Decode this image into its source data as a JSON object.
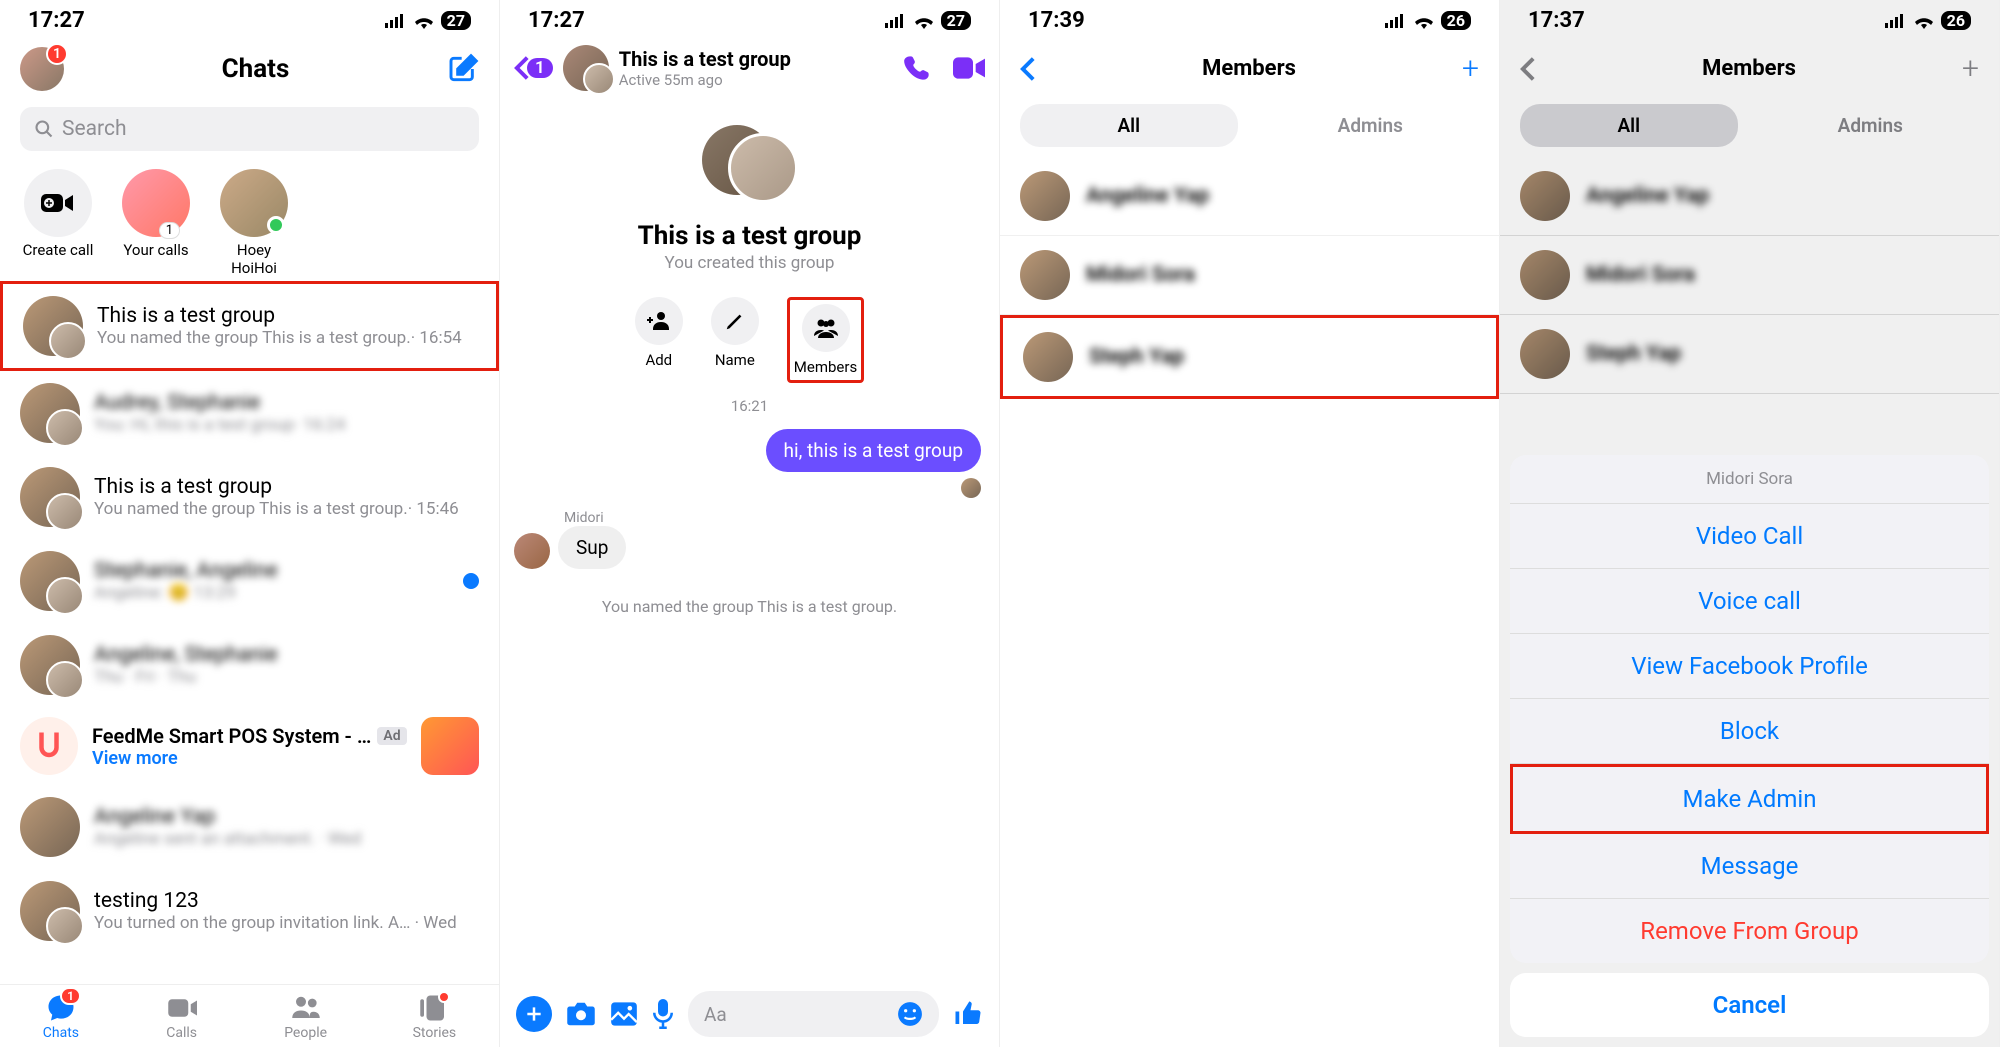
{
  "status": {
    "signal_icon": "signal",
    "wifi_icon": "wifi"
  },
  "p1": {
    "time": "17:27",
    "battery": "27",
    "avatar_badge": "1",
    "title": "Chats",
    "search_placeholder": "Search",
    "horiz": {
      "create_call": "Create call",
      "your_calls": "Your calls",
      "your_calls_badge": "1",
      "person": "Hoey HoiHoi"
    },
    "chats": [
      {
        "title": "This is a test group",
        "sub": "You named the group This is a test group.· 16:54",
        "highlight": true,
        "double": true
      },
      {
        "title": "Audrey, Stephanie",
        "sub": "You: Hi, this is a test group· 16:24",
        "blur": true,
        "double": true
      },
      {
        "title": "This is a test group",
        "sub": "You named the group This is a test group.· 15:46",
        "double": true
      },
      {
        "title": "Stephanie, Angeline",
        "sub": "Angeline: 😊  13:29",
        "blur": true,
        "double": true,
        "unread": true
      },
      {
        "title": "Angeline, Stephanie",
        "sub": "Thu · Fri · Thu",
        "blur": true,
        "double": true
      }
    ],
    "ad": {
      "title": "FeedMe Smart POS System - …",
      "pill": "Ad",
      "link": "View more"
    },
    "chats2": [
      {
        "title": "Angeline Yap",
        "sub": "Angeline sent an attachment. · Wed",
        "blur": true
      },
      {
        "title": "testing 123",
        "sub": "You turned on the group invitation link. A… · Wed",
        "double": true
      }
    ],
    "tabs": {
      "chats": "Chats",
      "calls": "Calls",
      "people": "People",
      "stories": "Stories",
      "chats_badge": "1"
    }
  },
  "p2": {
    "time": "17:27",
    "battery": "27",
    "back_badge": "1",
    "hdr_title": "This is a test group",
    "hdr_sub": "Active 55m ago",
    "hero_title": "This is a test group",
    "hero_sub": "You created this group",
    "actions": {
      "add": "Add",
      "name": "Name",
      "members": "Members"
    },
    "ts": "16:21",
    "msg_out": "hi, this is a test group",
    "sender": "Midori",
    "msg_in": "Sup",
    "sys": "You named the group This is a test group.",
    "compose_placeholder": "Aa"
  },
  "p3": {
    "time": "17:39",
    "battery": "26",
    "title": "Members",
    "seg_all": "All",
    "seg_admins": "Admins",
    "members": [
      {
        "name": "Angeline Yap",
        "blur": true
      },
      {
        "name": "Midori Sora",
        "blur": true
      },
      {
        "name": "Steph Yap",
        "blur": true,
        "highlight": true
      }
    ]
  },
  "p4": {
    "time": "17:37",
    "battery": "26",
    "title": "Members",
    "seg_all": "All",
    "seg_admins": "Admins",
    "members": [
      {
        "name": "Angeline Yap",
        "blur": true
      },
      {
        "name": "Midori Sora",
        "blur": true
      },
      {
        "name": "Steph Yap",
        "blur": true
      }
    ],
    "sheet_title": "Midori Sora",
    "sheet_buttons": [
      {
        "label": "Video Call"
      },
      {
        "label": "Voice call"
      },
      {
        "label": "View Facebook Profile"
      },
      {
        "label": "Block"
      },
      {
        "label": "Make Admin",
        "highlight": true
      },
      {
        "label": "Message"
      },
      {
        "label": "Remove From Group",
        "danger": true
      }
    ],
    "cancel": "Cancel"
  }
}
